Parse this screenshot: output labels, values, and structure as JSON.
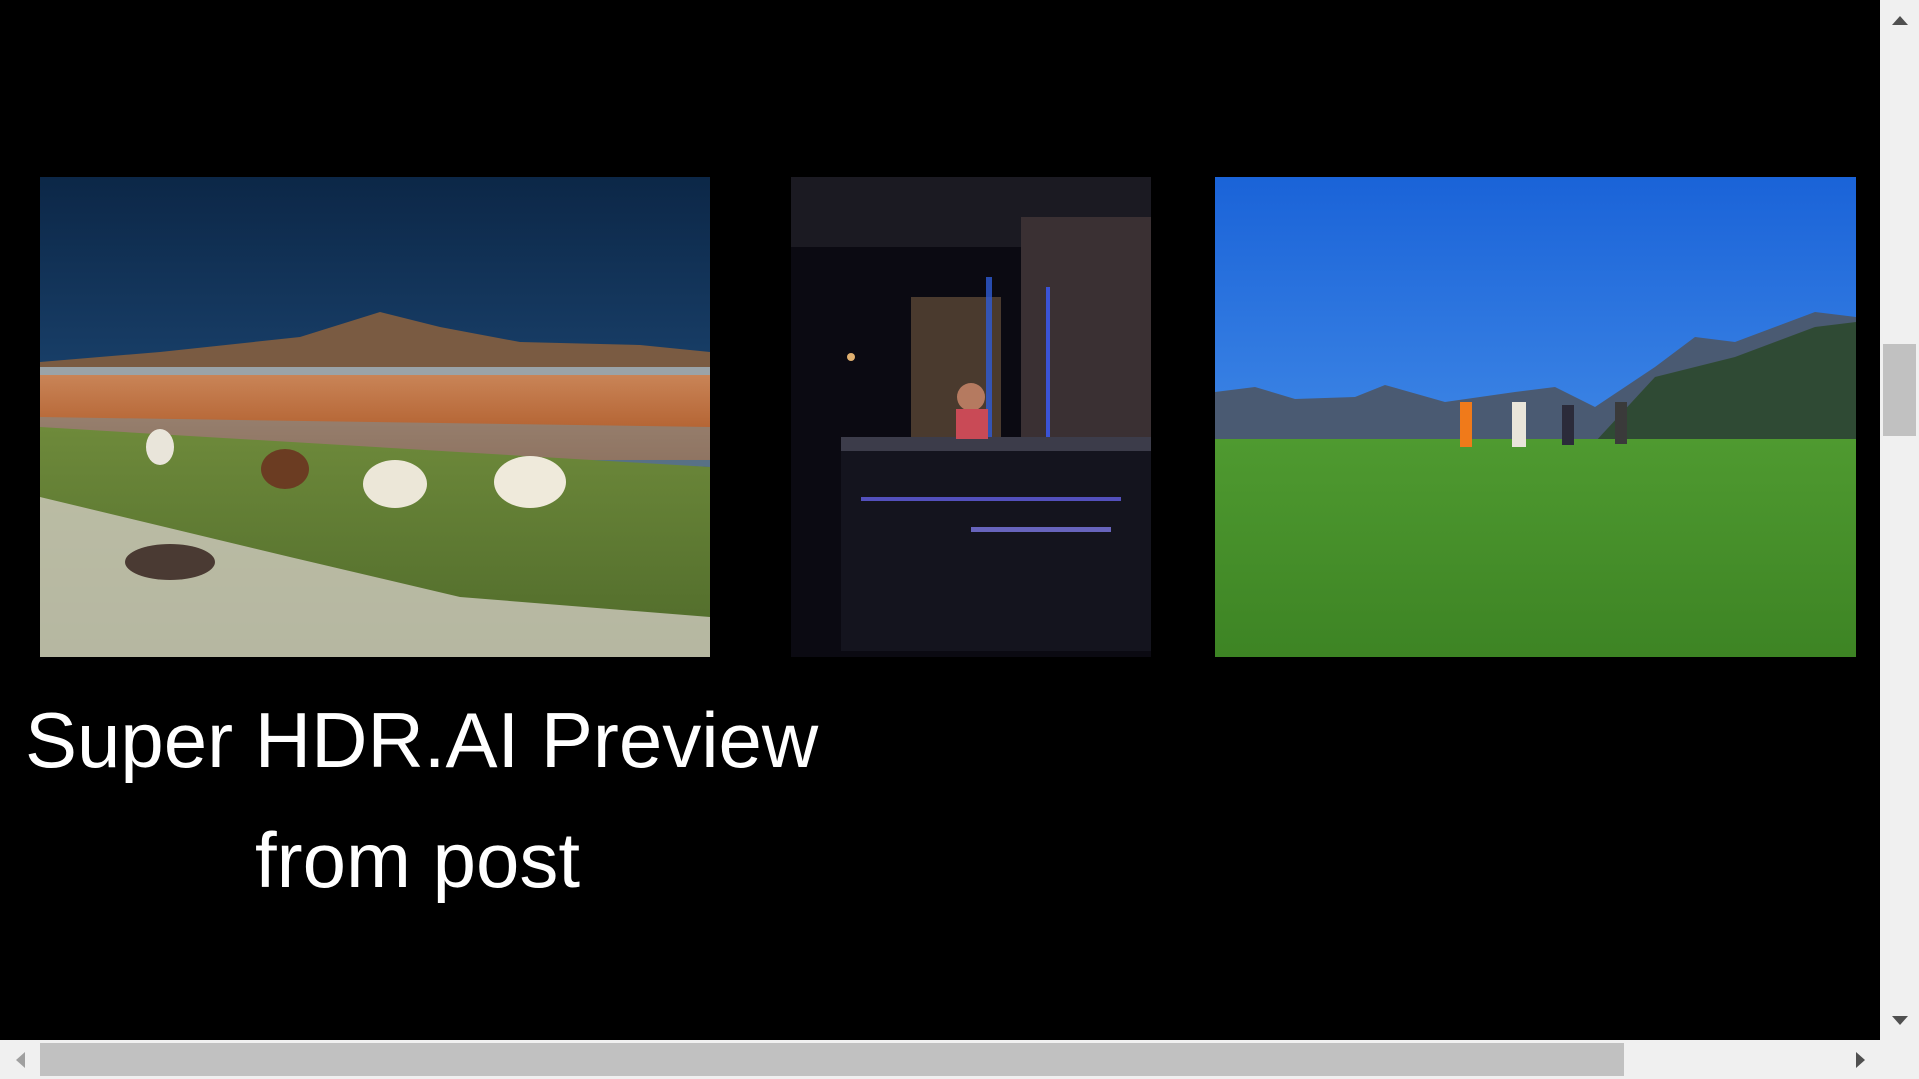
{
  "caption": {
    "line1": "Super HDR.AI Preview",
    "line2": "from post"
  },
  "photos": [
    {
      "name": "alpacas-lagoon-photo"
    },
    {
      "name": "neon-kitchen-photo"
    },
    {
      "name": "mountain-meadow-photo"
    }
  ],
  "scrollbars": {
    "vertical": {
      "up_icon": "triangle-up-icon",
      "down_icon": "triangle-down-icon"
    },
    "horizontal": {
      "left_icon": "triangle-left-icon",
      "right_icon": "triangle-right-icon"
    }
  },
  "colors": {
    "background": "#000000",
    "text": "#ffffff",
    "scrollbar_track": "#f0f0f0",
    "scrollbar_thumb": "#c1c1c1"
  }
}
